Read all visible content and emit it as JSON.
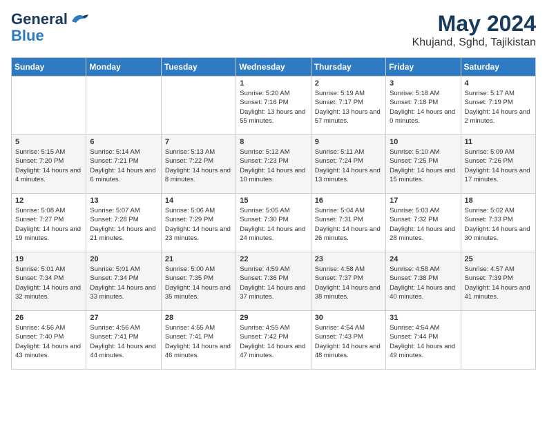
{
  "header": {
    "logo_general": "General",
    "logo_blue": "Blue",
    "title": "May 2024",
    "subtitle": "Khujand, Sghd, Tajikistan"
  },
  "days_of_week": [
    "Sunday",
    "Monday",
    "Tuesday",
    "Wednesday",
    "Thursday",
    "Friday",
    "Saturday"
  ],
  "weeks": [
    [
      {
        "day": "",
        "sunrise": "",
        "sunset": "",
        "daylight": ""
      },
      {
        "day": "",
        "sunrise": "",
        "sunset": "",
        "daylight": ""
      },
      {
        "day": "",
        "sunrise": "",
        "sunset": "",
        "daylight": ""
      },
      {
        "day": "1",
        "sunrise": "Sunrise: 5:20 AM",
        "sunset": "Sunset: 7:16 PM",
        "daylight": "Daylight: 13 hours and 55 minutes."
      },
      {
        "day": "2",
        "sunrise": "Sunrise: 5:19 AM",
        "sunset": "Sunset: 7:17 PM",
        "daylight": "Daylight: 13 hours and 57 minutes."
      },
      {
        "day": "3",
        "sunrise": "Sunrise: 5:18 AM",
        "sunset": "Sunset: 7:18 PM",
        "daylight": "Daylight: 14 hours and 0 minutes."
      },
      {
        "day": "4",
        "sunrise": "Sunrise: 5:17 AM",
        "sunset": "Sunset: 7:19 PM",
        "daylight": "Daylight: 14 hours and 2 minutes."
      }
    ],
    [
      {
        "day": "5",
        "sunrise": "Sunrise: 5:15 AM",
        "sunset": "Sunset: 7:20 PM",
        "daylight": "Daylight: 14 hours and 4 minutes."
      },
      {
        "day": "6",
        "sunrise": "Sunrise: 5:14 AM",
        "sunset": "Sunset: 7:21 PM",
        "daylight": "Daylight: 14 hours and 6 minutes."
      },
      {
        "day": "7",
        "sunrise": "Sunrise: 5:13 AM",
        "sunset": "Sunset: 7:22 PM",
        "daylight": "Daylight: 14 hours and 8 minutes."
      },
      {
        "day": "8",
        "sunrise": "Sunrise: 5:12 AM",
        "sunset": "Sunset: 7:23 PM",
        "daylight": "Daylight: 14 hours and 10 minutes."
      },
      {
        "day": "9",
        "sunrise": "Sunrise: 5:11 AM",
        "sunset": "Sunset: 7:24 PM",
        "daylight": "Daylight: 14 hours and 13 minutes."
      },
      {
        "day": "10",
        "sunrise": "Sunrise: 5:10 AM",
        "sunset": "Sunset: 7:25 PM",
        "daylight": "Daylight: 14 hours and 15 minutes."
      },
      {
        "day": "11",
        "sunrise": "Sunrise: 5:09 AM",
        "sunset": "Sunset: 7:26 PM",
        "daylight": "Daylight: 14 hours and 17 minutes."
      }
    ],
    [
      {
        "day": "12",
        "sunrise": "Sunrise: 5:08 AM",
        "sunset": "Sunset: 7:27 PM",
        "daylight": "Daylight: 14 hours and 19 minutes."
      },
      {
        "day": "13",
        "sunrise": "Sunrise: 5:07 AM",
        "sunset": "Sunset: 7:28 PM",
        "daylight": "Daylight: 14 hours and 21 minutes."
      },
      {
        "day": "14",
        "sunrise": "Sunrise: 5:06 AM",
        "sunset": "Sunset: 7:29 PM",
        "daylight": "Daylight: 14 hours and 23 minutes."
      },
      {
        "day": "15",
        "sunrise": "Sunrise: 5:05 AM",
        "sunset": "Sunset: 7:30 PM",
        "daylight": "Daylight: 14 hours and 24 minutes."
      },
      {
        "day": "16",
        "sunrise": "Sunrise: 5:04 AM",
        "sunset": "Sunset: 7:31 PM",
        "daylight": "Daylight: 14 hours and 26 minutes."
      },
      {
        "day": "17",
        "sunrise": "Sunrise: 5:03 AM",
        "sunset": "Sunset: 7:32 PM",
        "daylight": "Daylight: 14 hours and 28 minutes."
      },
      {
        "day": "18",
        "sunrise": "Sunrise: 5:02 AM",
        "sunset": "Sunset: 7:33 PM",
        "daylight": "Daylight: 14 hours and 30 minutes."
      }
    ],
    [
      {
        "day": "19",
        "sunrise": "Sunrise: 5:01 AM",
        "sunset": "Sunset: 7:34 PM",
        "daylight": "Daylight: 14 hours and 32 minutes."
      },
      {
        "day": "20",
        "sunrise": "Sunrise: 5:01 AM",
        "sunset": "Sunset: 7:34 PM",
        "daylight": "Daylight: 14 hours and 33 minutes."
      },
      {
        "day": "21",
        "sunrise": "Sunrise: 5:00 AM",
        "sunset": "Sunset: 7:35 PM",
        "daylight": "Daylight: 14 hours and 35 minutes."
      },
      {
        "day": "22",
        "sunrise": "Sunrise: 4:59 AM",
        "sunset": "Sunset: 7:36 PM",
        "daylight": "Daylight: 14 hours and 37 minutes."
      },
      {
        "day": "23",
        "sunrise": "Sunrise: 4:58 AM",
        "sunset": "Sunset: 7:37 PM",
        "daylight": "Daylight: 14 hours and 38 minutes."
      },
      {
        "day": "24",
        "sunrise": "Sunrise: 4:58 AM",
        "sunset": "Sunset: 7:38 PM",
        "daylight": "Daylight: 14 hours and 40 minutes."
      },
      {
        "day": "25",
        "sunrise": "Sunrise: 4:57 AM",
        "sunset": "Sunset: 7:39 PM",
        "daylight": "Daylight: 14 hours and 41 minutes."
      }
    ],
    [
      {
        "day": "26",
        "sunrise": "Sunrise: 4:56 AM",
        "sunset": "Sunset: 7:40 PM",
        "daylight": "Daylight: 14 hours and 43 minutes."
      },
      {
        "day": "27",
        "sunrise": "Sunrise: 4:56 AM",
        "sunset": "Sunset: 7:41 PM",
        "daylight": "Daylight: 14 hours and 44 minutes."
      },
      {
        "day": "28",
        "sunrise": "Sunrise: 4:55 AM",
        "sunset": "Sunset: 7:41 PM",
        "daylight": "Daylight: 14 hours and 46 minutes."
      },
      {
        "day": "29",
        "sunrise": "Sunrise: 4:55 AM",
        "sunset": "Sunset: 7:42 PM",
        "daylight": "Daylight: 14 hours and 47 minutes."
      },
      {
        "day": "30",
        "sunrise": "Sunrise: 4:54 AM",
        "sunset": "Sunset: 7:43 PM",
        "daylight": "Daylight: 14 hours and 48 minutes."
      },
      {
        "day": "31",
        "sunrise": "Sunrise: 4:54 AM",
        "sunset": "Sunset: 7:44 PM",
        "daylight": "Daylight: 14 hours and 49 minutes."
      },
      {
        "day": "",
        "sunrise": "",
        "sunset": "",
        "daylight": ""
      }
    ]
  ]
}
